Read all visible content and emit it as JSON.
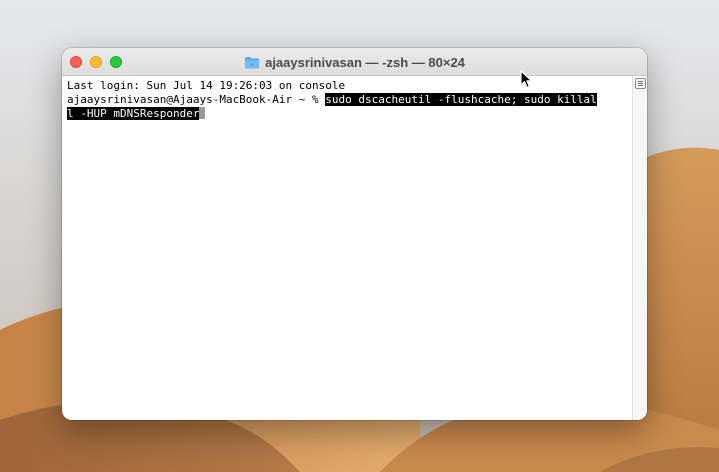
{
  "colors": {
    "terminal_bg": "#ffffff",
    "text": "#000000",
    "selection_bg": "#000000",
    "selection_text": "#ffffff",
    "close": "#fe5f57",
    "minimize": "#febc2e",
    "zoom": "#28c840",
    "folder": "#5aa9e6"
  },
  "window": {
    "title": "ajaaysrinivasan — -zsh — 80×24",
    "title_icon": "folder-icon"
  },
  "terminal": {
    "last_login": "Last login: Sun Jul 14 19:26:03 on console",
    "prompt": "ajaaysrinivasan@Ajaays-MacBook-Air ~ % ",
    "command_line1": "sudo dscacheutil -flushcache; sudo killal",
    "command_line2": "l -HUP mDNSResponder"
  },
  "icons": {
    "scrollbar_button": "split-pane-icon",
    "pointer": "mouse-pointer-icon"
  }
}
